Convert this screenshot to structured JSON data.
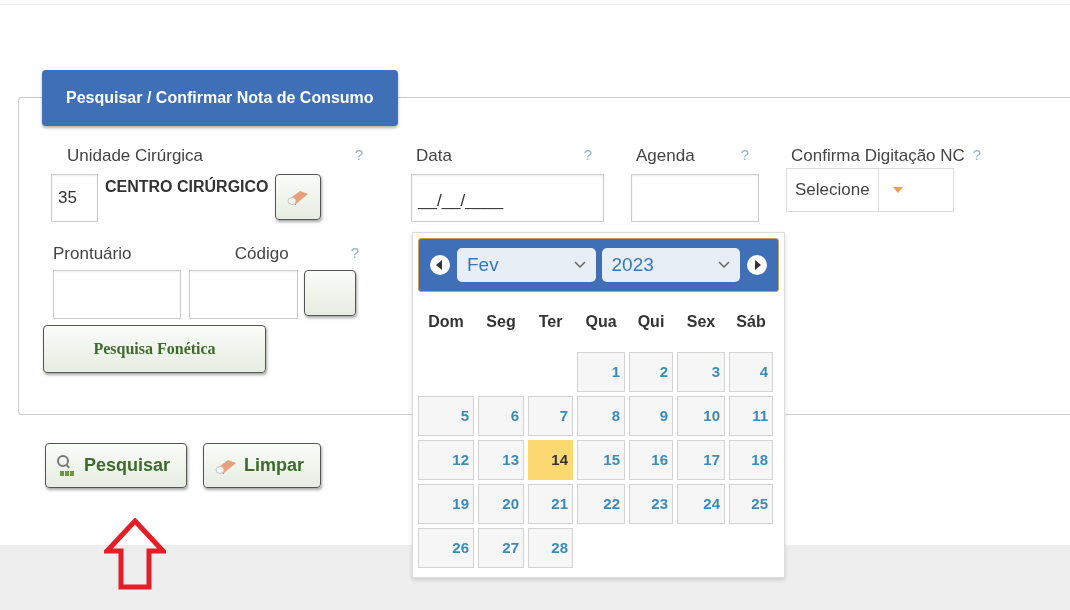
{
  "legend": "Pesquisar / Confirmar Nota de Consumo",
  "unit": {
    "label": "Unidade Cirúrgica",
    "help": "?",
    "code": "35",
    "name": "CENTRO CIRÚRGICO"
  },
  "date": {
    "label": "Data",
    "help": "?",
    "value": "__/__/____"
  },
  "agenda": {
    "label": "Agenda",
    "help": "?"
  },
  "confirm": {
    "label": "Confirma Digitação NC",
    "help": "?",
    "value": "Selecione"
  },
  "record": {
    "labels": [
      "Prontuário",
      "Código"
    ],
    "help": "?"
  },
  "phonetic_button": "Pesquisa Fonética",
  "actions": [
    {
      "label": "Pesquisar",
      "kind": "search"
    },
    {
      "label": "Limpar",
      "kind": "clear"
    }
  ],
  "calendar": {
    "month": "Fev",
    "year": "2023",
    "weekdays": [
      "Dom",
      "Seg",
      "Ter",
      "Qua",
      "Qui",
      "Sex",
      "Sáb"
    ],
    "weeks": [
      [
        {
          "day": "1",
          "selected": false
        },
        {
          "day": "2",
          "selected": false
        },
        {
          "day": "3",
          "selected": false
        },
        {
          "day": "4",
          "selected": false
        }
      ],
      [
        {
          "day": "5",
          "selected": false
        },
        {
          "day": "6",
          "selected": false
        },
        {
          "day": "7",
          "selected": false
        },
        {
          "day": "8",
          "selected": false
        },
        {
          "day": "9",
          "selected": false
        },
        {
          "day": "10",
          "selected": false
        },
        {
          "day": "11",
          "selected": false
        }
      ],
      [
        {
          "day": "12",
          "selected": false
        },
        {
          "day": "13",
          "selected": false
        },
        {
          "day": "14",
          "selected": true
        },
        {
          "day": "15",
          "selected": false
        },
        {
          "day": "16",
          "selected": false
        },
        {
          "day": "17",
          "selected": false
        },
        {
          "day": "18",
          "selected": false
        }
      ],
      [
        {
          "day": "19",
          "selected": false
        },
        {
          "day": "20",
          "selected": false
        },
        {
          "day": "21",
          "selected": false
        },
        {
          "day": "22",
          "selected": false
        },
        {
          "day": "23",
          "selected": false
        },
        {
          "day": "24",
          "selected": false
        },
        {
          "day": "25",
          "selected": false
        }
      ],
      [
        {
          "day": "26",
          "selected": false
        },
        {
          "day": "27",
          "selected": false
        },
        {
          "day": "28",
          "selected": false
        }
      ]
    ]
  }
}
